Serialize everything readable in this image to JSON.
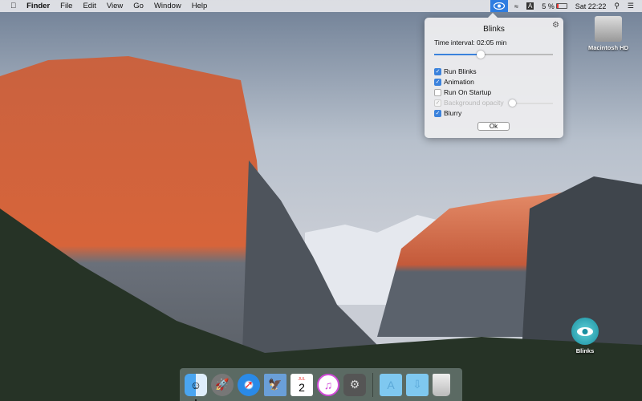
{
  "menubar": {
    "apple_icon": "apple-icon",
    "app": "Finder",
    "items": [
      "File",
      "Edit",
      "View",
      "Go",
      "Window",
      "Help"
    ],
    "status": {
      "input_source": "A",
      "battery": "5 %",
      "clock": "Sat 22:22"
    }
  },
  "popup": {
    "title": "Blinks",
    "interval_label": "Time interval: 02:05 min",
    "interval_fraction": 0.39,
    "options": [
      {
        "label": "Run Blinks",
        "checked": true,
        "enabled": true
      },
      {
        "label": "Animation",
        "checked": true,
        "enabled": true
      },
      {
        "label": "Run On Startup",
        "checked": false,
        "enabled": true
      },
      {
        "label": "Background opacity",
        "checked": true,
        "enabled": false
      },
      {
        "label": "Blurry",
        "checked": true,
        "enabled": true
      }
    ],
    "opacity_fraction": 0.0,
    "ok_label": "Ok"
  },
  "desktop": {
    "disk_label": "Macintosh HD",
    "app_label": "Blinks"
  },
  "dock": {
    "items": [
      "Finder",
      "Launchpad",
      "Safari",
      "Preview",
      "Calendar",
      "iTunes",
      "System Preferences",
      "Applications",
      "Downloads",
      "Trash"
    ],
    "calendar_month": "JUL",
    "calendar_day": "2"
  },
  "colors": {
    "accent": "#3b82dc"
  }
}
